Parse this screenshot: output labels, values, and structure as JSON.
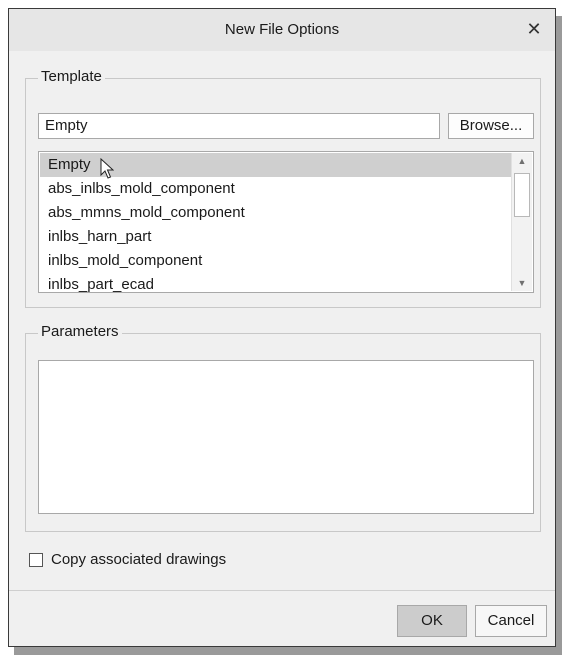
{
  "dialog": {
    "title": "New File Options",
    "close_icon": "close-icon"
  },
  "template": {
    "legend": "Template",
    "input_value": "Empty",
    "browse_label": "Browse...",
    "list": [
      "Empty",
      "abs_inlbs_mold_component",
      "abs_mmns_mold_component",
      "inlbs_harn_part",
      "inlbs_mold_component",
      "inlbs_part_ecad"
    ],
    "selected_index": 0
  },
  "parameters": {
    "legend": "Parameters"
  },
  "copy_drawings": {
    "label": "Copy associated drawings",
    "checked": false
  },
  "footer": {
    "ok_label": "OK",
    "cancel_label": "Cancel"
  },
  "colors": {
    "selected_row": "#cfcfcf",
    "ok_button": "#cccccc",
    "titlebar": "#e6e6e6"
  }
}
